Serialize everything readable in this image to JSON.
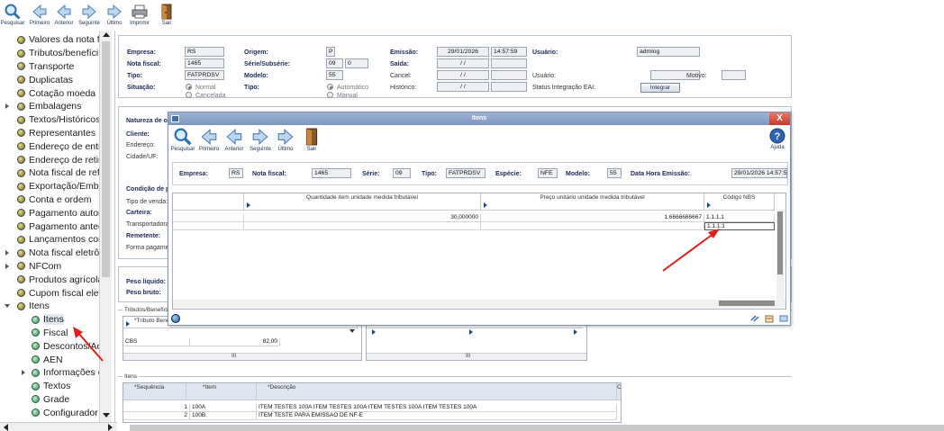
{
  "toolbar": {
    "buttons": [
      {
        "label": "Pesquisar",
        "icon": "magnifier-icon"
      },
      {
        "label": "Primeiro",
        "icon": "first-arrow-icon"
      },
      {
        "label": "Anterior",
        "icon": "previous-arrow-icon"
      },
      {
        "label": "Seguinte",
        "icon": "next-arrow-icon"
      },
      {
        "label": "Último",
        "icon": "last-arrow-icon"
      },
      {
        "label": "Imprimir",
        "icon": "printer-icon"
      },
      {
        "label": "Sair",
        "icon": "exit-door-icon"
      }
    ]
  },
  "tree": {
    "items": [
      "Valores da nota fis",
      "Tributos/benefíci",
      "Transporte",
      "Duplicatas",
      "Cotação moeda",
      "Embalagens",
      "Textos/Históricos",
      "Representantes",
      "Endereço de entre",
      "Endereço de retira",
      "Nota fiscal de refe",
      "Exportação/Emba",
      "Conta e ordem",
      "Pagamento autom",
      "Pagamento anteci",
      "Lançamentos con",
      "Nota fiscal eletrôn",
      "NFCom",
      "Produtos agrícola",
      "Cupom fiscal eletr",
      "Itens"
    ],
    "children": [
      "Itens",
      "Fiscal",
      "Descontos/Ac",
      "AEN",
      "Informações c",
      "Textos",
      "Grade",
      "Configurador"
    ]
  },
  "header": {
    "empresa_label": "Empresa:",
    "empresa": "RS",
    "nota_label": "Nota fiscal:",
    "nota": "1465",
    "tipo_label": "Tipo:",
    "tipo": "FATPRDSV",
    "situacao_label": "Situação:",
    "situacao_opt1": "Normal",
    "situacao_opt2": "Cancelada",
    "origem_label": "Origem:",
    "origem": "P",
    "serie_label": "Série/Subsérie:",
    "serie": "09",
    "subserie": "0",
    "modelo_label": "Modelo:",
    "modelo": "55",
    "tipo2_label": "Tipo:",
    "tipo2_opt1": "Automático",
    "tipo2_opt2": "Manual",
    "emissao_label": "Emissão:",
    "emissao_data": "29/01/2026",
    "emissao_hora": "14:57:59",
    "saida_label": "Saída:",
    "saida": "/ /",
    "cancel_label": "Cancel:",
    "cancel": "/ /",
    "historico_label": "Histórico:",
    "historico": "/ /",
    "usuario_label": "Usuário:",
    "usuario": "admlog",
    "usuario2_label": "Usuário:",
    "motivo_label": "Motivo:",
    "status_label": "Status Integração EAI:",
    "integrar": "Integrar"
  },
  "left_labels": [
    "Natureza de oper",
    "Cliente:",
    "Endereço:",
    "Cidade/UF:",
    "Condição de paga",
    "Tipo de venda:",
    "Carteira:",
    "Transportadora:",
    "Remetente:",
    "Forma pagamento",
    "Peso líquido:",
    "Peso bruto:"
  ],
  "tributos": {
    "section": "Tributos/Benefícios",
    "col": "*Tributo Benef",
    "row_name": "CBS",
    "row_value": "82,00"
  },
  "itens": {
    "section": "Itens",
    "cols": [
      "*Sequência",
      "*Item",
      "*Descrição",
      "C"
    ],
    "rows": [
      {
        "seq": "1",
        "item": "100A",
        "desc": "ITEM TESTES 100A ITEM TESTES 100A ITEM TESTES 100A ITEM TESTES 100A"
      },
      {
        "seq": "2",
        "item": "100B",
        "desc": "ITEM TESTE PARA EMISSAO DE NF-E"
      }
    ]
  },
  "dialog": {
    "title": "Itens",
    "close": "X",
    "help": "Ajuda",
    "empresa_label": "Empresa:",
    "empresa": "RS",
    "nota_label": "Nota fiscal:",
    "nota": "1465",
    "serie_label": "Série:",
    "serie": "09",
    "tipo_label": "Tipo:",
    "tipo": "FATPRDSV",
    "especie_label": "Espécie:",
    "especie": "NFE",
    "modelo_label": "Modelo:",
    "modelo": "55",
    "data_label": "Data Hora Emissão:",
    "data": "29/01/2026 14:57:59",
    "grid_cols": [
      "Quantidade item unidade medida tributável",
      "Preço unitário unidade medida tributável",
      "Código NBS"
    ],
    "grid_row1": {
      "qtd": "30,000000",
      "preco": "1,6666666667",
      "nbs": "1.1.1.1"
    },
    "grid_row2": {
      "nbs": "1.1.1.1"
    }
  },
  "colors": {
    "accent_arrow": "#e0201c",
    "title_bar": "#8aa0c8"
  }
}
